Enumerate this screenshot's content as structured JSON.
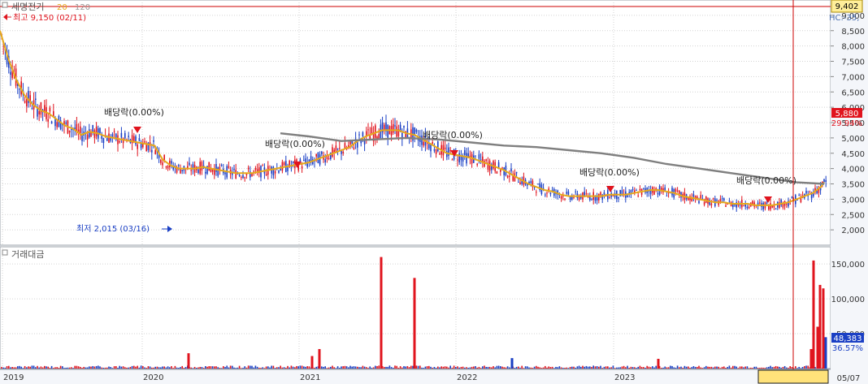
{
  "colors": {
    "bg": "#ffffff",
    "grid": "#d3d3d3",
    "up": "#e0141e",
    "down": "#1a3fc4",
    "ma20": "#e6a91a",
    "ma120": "#7f7f7f",
    "crosshair": "#cc0000",
    "axis_text": "#333333",
    "panel_border": "#9aa0aa"
  },
  "header": {
    "stock_name": "세명전기",
    "ma_short_label": "20",
    "ma_long_label": "120",
    "right_top_price": "9,402",
    "right_top_sub": "HC:-35,"
  },
  "annotations": {
    "high_label": "최고 9,150 (02/11)",
    "low_label": "최저 2,015 (03/16)",
    "dividend_label": "배당락(0.00%)",
    "current_price_label": "5,880",
    "current_change_label": "29.94%"
  },
  "volume_panel": {
    "title": "거래대금",
    "current_value_label": "48,383",
    "current_pct_label": "36.57%"
  },
  "x_axis": {
    "labels": [
      "2019",
      "2020",
      "2021",
      "2022",
      "2023"
    ],
    "cursor_date": "05/07"
  },
  "chart_data": [
    {
      "type": "candlestick",
      "ylim": [
        1500,
        9500
      ],
      "y_ticks": [
        "9,000",
        "8,500",
        "8,000",
        "7,500",
        "7,000",
        "6,500",
        "6,000",
        "5,500",
        "5,000",
        "4,500",
        "4,000",
        "3,500",
        "3,000",
        "2,500",
        "2,000"
      ],
      "series": [
        {
          "name": "20",
          "role": "moving-average",
          "x": [
            0,
            10,
            20,
            30,
            40,
            50,
            60,
            70,
            80,
            90,
            100,
            110,
            120,
            130,
            140,
            150,
            160,
            170,
            180,
            190,
            200,
            210,
            220,
            230,
            240,
            250,
            260,
            270,
            280,
            290,
            300,
            310,
            320,
            330,
            340,
            350,
            360,
            370,
            380,
            390,
            400,
            410,
            420,
            430,
            440,
            450,
            460,
            470,
            480,
            490,
            500,
            510,
            520,
            530,
            540,
            550,
            560,
            570,
            580,
            590,
            600,
            610,
            620,
            630,
            640,
            650,
            660,
            670,
            680,
            690,
            700,
            710,
            720,
            730,
            740,
            750,
            760,
            770,
            780,
            790,
            800,
            810,
            820,
            830,
            840,
            850,
            860,
            870,
            880,
            890,
            900,
            910,
            920,
            930,
            940,
            950,
            960,
            970,
            980,
            990,
            1000,
            1010,
            1014
          ],
          "values": [
            8500,
            7600,
            6900,
            6400,
            6100,
            5900,
            5800,
            5600,
            5400,
            5300,
            5100,
            5200,
            5150,
            5050,
            5000,
            4950,
            4900,
            4850,
            4800,
            4750,
            4300,
            4100,
            4000,
            4000,
            4000,
            4050,
            4000,
            3950,
            3900,
            3850,
            3850,
            3850,
            3900,
            3950,
            4000,
            4050,
            4100,
            4150,
            4200,
            4300,
            4400,
            4500,
            4600,
            4700,
            4900,
            5050,
            5150,
            5250,
            5250,
            5250,
            5150,
            5100,
            4950,
            4800,
            4650,
            4500,
            4450,
            4400,
            4350,
            4250,
            4150,
            4050,
            3950,
            3800,
            3650,
            3500,
            3400,
            3300,
            3250,
            3150,
            3100,
            3100,
            3100,
            3100,
            3100,
            3150,
            3150,
            3150,
            3200,
            3250,
            3300,
            3300,
            3250,
            3200,
            3100,
            3050,
            3000,
            2950,
            2900,
            2900,
            2850,
            2850,
            2850,
            2800,
            2800,
            2800,
            2850,
            2900,
            3000,
            3100,
            3200,
            3400,
            3550
          ]
        },
        {
          "name": "120",
          "role": "moving-average",
          "x": [
            345,
            380,
            420,
            460,
            500,
            540,
            580,
            620,
            660,
            700,
            740,
            780,
            820,
            860,
            900,
            940,
            980,
            1014
          ],
          "values": [
            5150,
            5050,
            4900,
            4950,
            5000,
            4950,
            4850,
            4750,
            4700,
            4600,
            4500,
            4350,
            4150,
            4000,
            3850,
            3700,
            3550,
            3500
          ]
        }
      ],
      "volume": {
        "y_ticks": [
          "150,000",
          "100,000",
          "50,000"
        ],
        "ylim": [
          0,
          170000
        ],
        "spikes": [
          {
            "x": 232,
            "value": 22000,
            "dir": "up"
          },
          {
            "x": 384,
            "value": 18000,
            "dir": "up"
          },
          {
            "x": 393,
            "value": 28000,
            "dir": "up"
          },
          {
            "x": 469,
            "value": 160000,
            "dir": "up"
          },
          {
            "x": 510,
            "value": 130000,
            "dir": "up"
          },
          {
            "x": 630,
            "value": 15000,
            "dir": "down"
          },
          {
            "x": 810,
            "value": 14000,
            "dir": "up"
          },
          {
            "x": 998,
            "value": 28000,
            "dir": "up"
          },
          {
            "x": 1001,
            "value": 155000,
            "dir": "up"
          },
          {
            "x": 1006,
            "value": 60000,
            "dir": "up"
          },
          {
            "x": 1009,
            "value": 120000,
            "dir": "up"
          },
          {
            "x": 1013,
            "value": 115000,
            "dir": "up"
          },
          {
            "x": 1016,
            "value": 45000,
            "dir": "down"
          }
        ]
      }
    }
  ]
}
